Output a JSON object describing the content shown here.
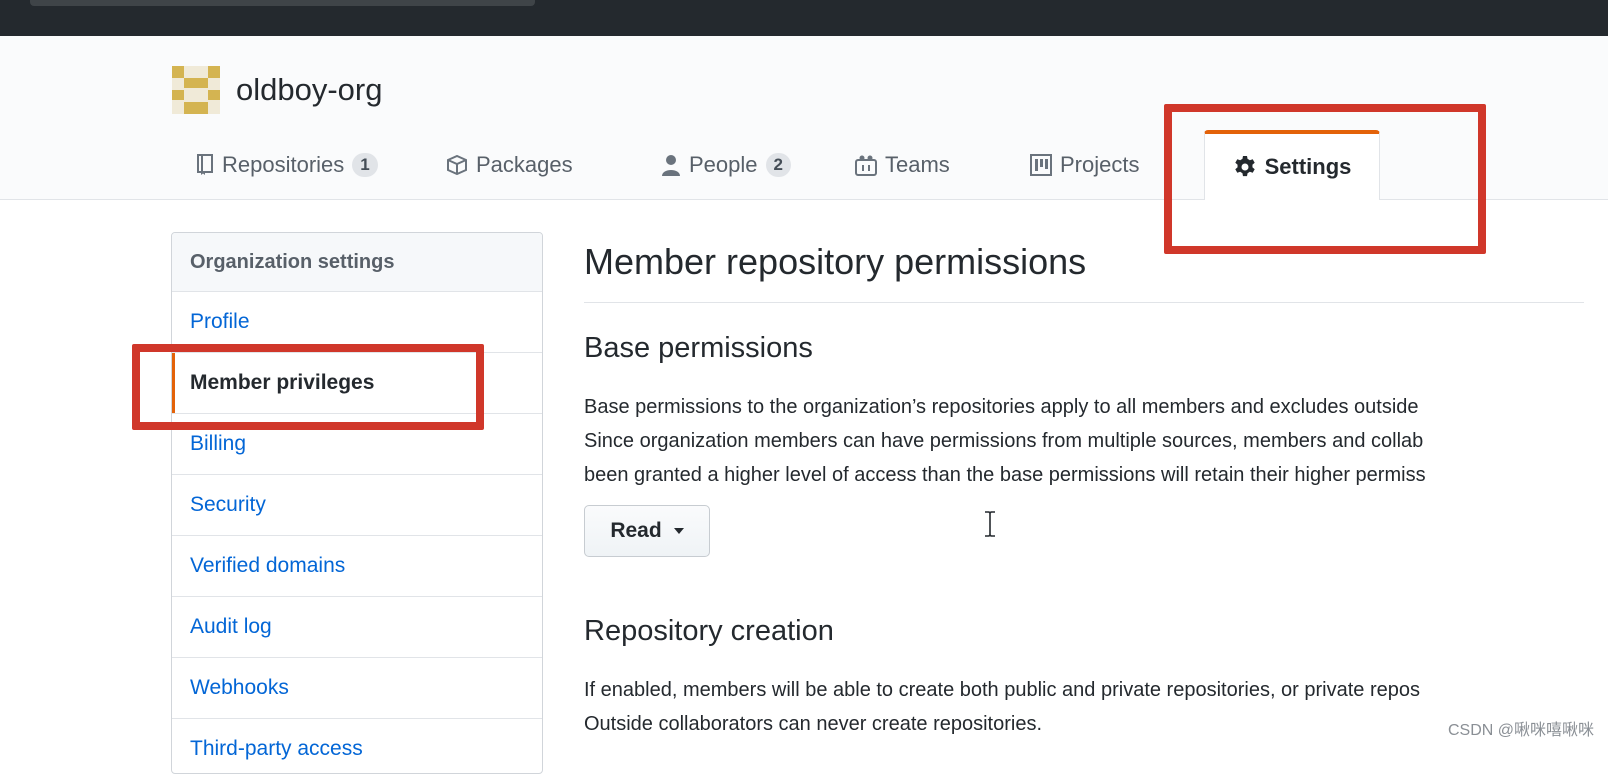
{
  "org": {
    "name": "oldboy-org"
  },
  "tabs": [
    {
      "label": "Repositories",
      "count": "1",
      "icon": "repo-icon"
    },
    {
      "label": "Packages",
      "count": "",
      "icon": "package-icon"
    },
    {
      "label": "People",
      "count": "2",
      "icon": "person-icon"
    },
    {
      "label": "Teams",
      "count": "",
      "icon": "people-icon"
    },
    {
      "label": "Projects",
      "count": "",
      "icon": "project-icon"
    },
    {
      "label": "Settings",
      "count": "",
      "icon": "gear-icon",
      "selected": true
    }
  ],
  "sidebar": {
    "heading": "Organization settings",
    "items": [
      {
        "label": "Profile"
      },
      {
        "label": "Member privileges",
        "active": true
      },
      {
        "label": "Billing"
      },
      {
        "label": "Security"
      },
      {
        "label": "Verified domains"
      },
      {
        "label": "Audit log"
      },
      {
        "label": "Webhooks"
      },
      {
        "label": "Third-party access"
      }
    ]
  },
  "main": {
    "title": "Member repository permissions",
    "base": {
      "heading": "Base permissions",
      "lines": [
        "Base permissions to the organization’s repositories apply to all members and excludes outside",
        "Since organization members can have permissions from multiple sources, members and collab",
        "been granted a higher level of access than the base permissions will retain their higher permiss"
      ],
      "select_value": "Read"
    },
    "creation": {
      "heading": "Repository creation",
      "lines": [
        "If enabled, members will be able to create both public and private repositories, or private repos",
        "Outside collaborators can never create repositories."
      ]
    }
  },
  "watermark": "CSDN @啾咪嘻啾咪",
  "colors": {
    "accent": "#e36209",
    "link": "#0366d6",
    "highlight": "#d0372a",
    "topbar": "#24292e"
  }
}
